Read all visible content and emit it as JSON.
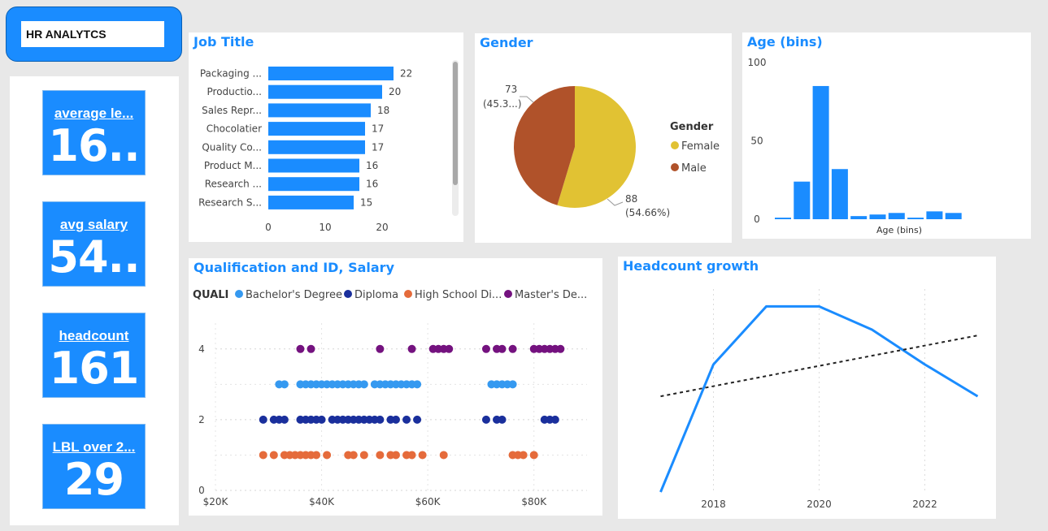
{
  "header": {
    "title": "HR ANALYTCS"
  },
  "cards": [
    {
      "label": "average le...",
      "value": "16.."
    },
    {
      "label": "avg salary",
      "value": "54.."
    },
    {
      "label": "headcount",
      "value": "161"
    },
    {
      "label": "LBL over 2...",
      "value": "29"
    }
  ],
  "colors": {
    "accent": "#1a8cff",
    "female": "#e1c233",
    "male": "#b0522a",
    "bachelor": "#3599f0",
    "diploma": "#1a2f9c",
    "highschool": "#e56b3b",
    "masters": "#74127f"
  },
  "chart_data": [
    {
      "type": "bar",
      "title": "Job Title",
      "orientation": "horizontal",
      "categories": [
        "Packaging ...",
        "Productio...",
        "Sales Repr...",
        "Chocolatier",
        "Quality Co...",
        "Product M...",
        "Research ...",
        "Research S..."
      ],
      "values": [
        22,
        20,
        18,
        17,
        17,
        16,
        16,
        15
      ],
      "xticks": [
        "0",
        "10",
        "20"
      ],
      "xlim": [
        0,
        25
      ]
    },
    {
      "type": "pie",
      "title": "Gender",
      "legend_title": "Gender",
      "legend_position": "right",
      "slices": [
        {
          "name": "Female",
          "value": 88,
          "label_value": "88",
          "label_pct": "(54.66%)"
        },
        {
          "name": "Male",
          "value": 73,
          "label_value": "73",
          "label_pct": "(45.3...)"
        }
      ]
    },
    {
      "type": "bar",
      "title": "Age (bins)",
      "xlabel": "Age (bins)",
      "values": [
        1,
        24,
        85,
        32,
        2,
        3,
        4,
        1,
        5,
        4
      ],
      "yticks": [
        "0",
        "50",
        "100"
      ],
      "ylim": [
        0,
        100
      ]
    },
    {
      "type": "scatter",
      "title": "Qualification and ID, Salary",
      "legend_title": "QUALI",
      "legend_position": "top",
      "xticks": [
        "$20K",
        "$40K",
        "$60K",
        "$80K"
      ],
      "xlim": [
        20000,
        90000
      ],
      "yticks": [
        "0",
        "2",
        "4"
      ],
      "ylim": [
        0,
        4.5
      ],
      "series": [
        {
          "name": "Bachelor's Degree",
          "y": 3,
          "x": [
            32000,
            33000,
            36000,
            37000,
            38000,
            39000,
            40000,
            41000,
            42000,
            43000,
            44000,
            45000,
            46000,
            47000,
            48000,
            50000,
            51000,
            52000,
            53000,
            54000,
            55000,
            56000,
            57000,
            58000,
            72000,
            73000,
            74000,
            75000,
            76000
          ]
        },
        {
          "name": "Diploma",
          "y": 2,
          "x": [
            29000,
            31000,
            32000,
            33000,
            36000,
            37000,
            38000,
            39000,
            40000,
            42000,
            43000,
            44000,
            45000,
            46000,
            47000,
            48000,
            49000,
            50000,
            51000,
            53000,
            54000,
            56000,
            58000,
            71000,
            73000,
            74000,
            82000,
            83000,
            84000
          ]
        },
        {
          "name": "High School Di...",
          "y": 1,
          "x": [
            29000,
            31000,
            33000,
            34000,
            35000,
            36000,
            37000,
            38000,
            39000,
            41000,
            45000,
            46000,
            48000,
            51000,
            53000,
            54000,
            56000,
            57000,
            59000,
            63000,
            76000,
            77000,
            78000,
            80000
          ]
        },
        {
          "name": "Master's De...",
          "y": 4,
          "x": [
            36000,
            38000,
            51000,
            57000,
            61000,
            62000,
            63000,
            64000,
            71000,
            73000,
            74000,
            76000,
            80000,
            81000,
            82000,
            83000,
            84000,
            85000
          ]
        }
      ]
    },
    {
      "type": "line",
      "title": "Headcount growth",
      "xticks": [
        "2018",
        "2020",
        "2022"
      ],
      "x": [
        2017,
        2018,
        2019,
        2020,
        2021,
        2022,
        2023
      ],
      "y": [
        0,
        44,
        64,
        64,
        56,
        44,
        33
      ],
      "trend": {
        "x": [
          2017,
          2023
        ],
        "y": [
          33,
          54
        ]
      },
      "xlim": [
        2016.5,
        2023.3
      ],
      "ylim": [
        0,
        70
      ]
    }
  ]
}
